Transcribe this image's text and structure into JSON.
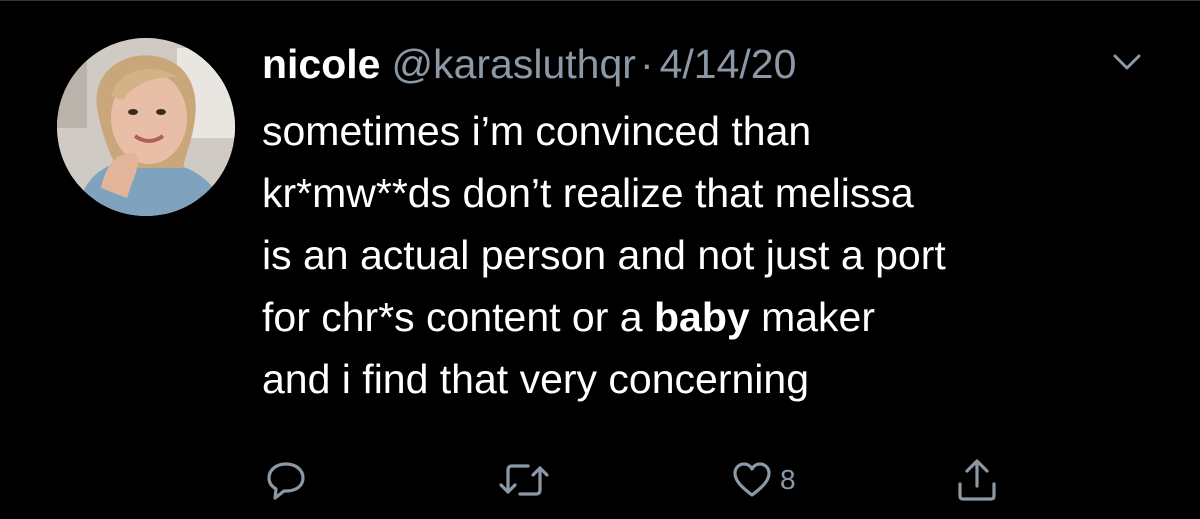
{
  "tweet": {
    "display_name": "nicole",
    "handle": "@karasluthqr",
    "separator": "·",
    "date": "4/14/20",
    "text_lines": [
      {
        "parts": [
          "sometimes i’m convinced than"
        ]
      },
      {
        "parts": [
          "kr*mw**ds don’t realize that melissa"
        ]
      },
      {
        "parts": [
          "is an actual person and not just a port"
        ]
      },
      {
        "pre": "for chr*s content or a ",
        "bold": "baby",
        "post": " maker"
      },
      {
        "parts": [
          "and i find that very concerning"
        ]
      }
    ],
    "like_count": "8"
  },
  "icons": {
    "avatar": "profile-photo",
    "caret": "chevron-down-icon",
    "reply": "reply-icon",
    "retweet": "retweet-icon",
    "like": "heart-icon",
    "share": "share-icon"
  },
  "colors": {
    "background": "#000000",
    "text": "#ffffff",
    "secondary": "#8b98a5"
  }
}
